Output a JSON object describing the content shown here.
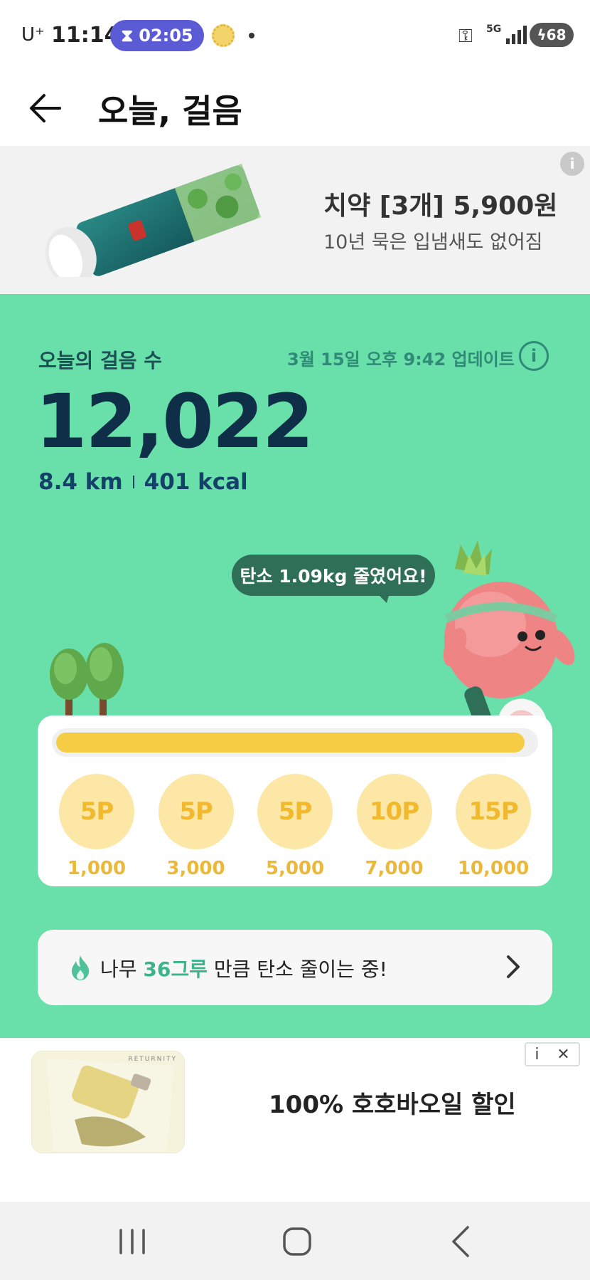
{
  "status_bar": {
    "carrier": "U⁺",
    "time": "11:14",
    "timer": "02:05",
    "network": "5G",
    "battery": "68"
  },
  "header": {
    "title": "오늘, 걸음"
  },
  "top_ad": {
    "title": "치약 [3개] 5,900원",
    "subtitle": "10년 묵은 입냄새도 없어짐",
    "info_label": "i"
  },
  "steps": {
    "label": "오늘의 걸음 수",
    "updated": "3월 15일 오후 9:42 업데이트",
    "count": "12,022",
    "distance": "8.4 km",
    "calories": "401 kcal",
    "info_label": "i"
  },
  "carbon_bubble": "탄소 1.09kg 줄였어요!",
  "progress": {
    "fraction": 0.98,
    "milestones": [
      {
        "points": "5P",
        "steps": "1,000"
      },
      {
        "points": "5P",
        "steps": "3,000"
      },
      {
        "points": "5P",
        "steps": "5,000"
      },
      {
        "points": "10P",
        "steps": "7,000"
      },
      {
        "points": "15P",
        "steps": "10,000"
      }
    ]
  },
  "tree_banner": {
    "prefix": "나무 ",
    "highlight": "36그루",
    "suffix": " 만큼 탄소 줄이는 중!"
  },
  "bottom_ad": {
    "brand": "RETURNITY",
    "text": "100% 호호바오일 할인",
    "info_label": "i",
    "close_label": "✕"
  },
  "colors": {
    "green_bg": "#69e0aa",
    "navy": "#0f2f49",
    "progress_yellow": "#f5cd45",
    "milestone_circle": "#fde7a6"
  }
}
